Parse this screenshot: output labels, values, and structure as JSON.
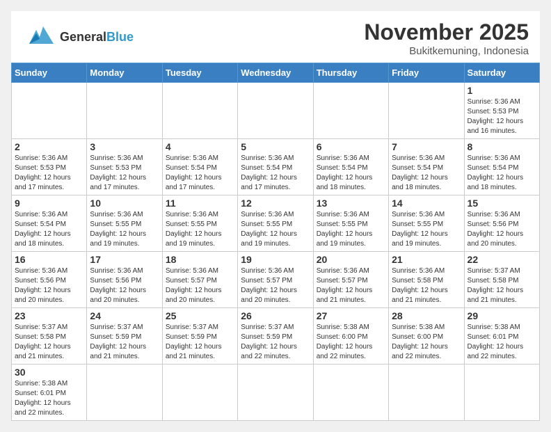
{
  "header": {
    "logo_general": "General",
    "logo_blue": "Blue",
    "month_title": "November 2025",
    "location": "Bukitkemuning, Indonesia"
  },
  "weekdays": [
    "Sunday",
    "Monday",
    "Tuesday",
    "Wednesday",
    "Thursday",
    "Friday",
    "Saturday"
  ],
  "weeks": [
    [
      {
        "day": "",
        "info": ""
      },
      {
        "day": "",
        "info": ""
      },
      {
        "day": "",
        "info": ""
      },
      {
        "day": "",
        "info": ""
      },
      {
        "day": "",
        "info": ""
      },
      {
        "day": "",
        "info": ""
      },
      {
        "day": "1",
        "info": "Sunrise: 5:36 AM\nSunset: 5:53 PM\nDaylight: 12 hours\nand 16 minutes."
      }
    ],
    [
      {
        "day": "2",
        "info": "Sunrise: 5:36 AM\nSunset: 5:53 PM\nDaylight: 12 hours\nand 17 minutes."
      },
      {
        "day": "3",
        "info": "Sunrise: 5:36 AM\nSunset: 5:53 PM\nDaylight: 12 hours\nand 17 minutes."
      },
      {
        "day": "4",
        "info": "Sunrise: 5:36 AM\nSunset: 5:54 PM\nDaylight: 12 hours\nand 17 minutes."
      },
      {
        "day": "5",
        "info": "Sunrise: 5:36 AM\nSunset: 5:54 PM\nDaylight: 12 hours\nand 17 minutes."
      },
      {
        "day": "6",
        "info": "Sunrise: 5:36 AM\nSunset: 5:54 PM\nDaylight: 12 hours\nand 18 minutes."
      },
      {
        "day": "7",
        "info": "Sunrise: 5:36 AM\nSunset: 5:54 PM\nDaylight: 12 hours\nand 18 minutes."
      },
      {
        "day": "8",
        "info": "Sunrise: 5:36 AM\nSunset: 5:54 PM\nDaylight: 12 hours\nand 18 minutes."
      }
    ],
    [
      {
        "day": "9",
        "info": "Sunrise: 5:36 AM\nSunset: 5:54 PM\nDaylight: 12 hours\nand 18 minutes."
      },
      {
        "day": "10",
        "info": "Sunrise: 5:36 AM\nSunset: 5:55 PM\nDaylight: 12 hours\nand 19 minutes."
      },
      {
        "day": "11",
        "info": "Sunrise: 5:36 AM\nSunset: 5:55 PM\nDaylight: 12 hours\nand 19 minutes."
      },
      {
        "day": "12",
        "info": "Sunrise: 5:36 AM\nSunset: 5:55 PM\nDaylight: 12 hours\nand 19 minutes."
      },
      {
        "day": "13",
        "info": "Sunrise: 5:36 AM\nSunset: 5:55 PM\nDaylight: 12 hours\nand 19 minutes."
      },
      {
        "day": "14",
        "info": "Sunrise: 5:36 AM\nSunset: 5:55 PM\nDaylight: 12 hours\nand 19 minutes."
      },
      {
        "day": "15",
        "info": "Sunrise: 5:36 AM\nSunset: 5:56 PM\nDaylight: 12 hours\nand 20 minutes."
      }
    ],
    [
      {
        "day": "16",
        "info": "Sunrise: 5:36 AM\nSunset: 5:56 PM\nDaylight: 12 hours\nand 20 minutes."
      },
      {
        "day": "17",
        "info": "Sunrise: 5:36 AM\nSunset: 5:56 PM\nDaylight: 12 hours\nand 20 minutes."
      },
      {
        "day": "18",
        "info": "Sunrise: 5:36 AM\nSunset: 5:57 PM\nDaylight: 12 hours\nand 20 minutes."
      },
      {
        "day": "19",
        "info": "Sunrise: 5:36 AM\nSunset: 5:57 PM\nDaylight: 12 hours\nand 20 minutes."
      },
      {
        "day": "20",
        "info": "Sunrise: 5:36 AM\nSunset: 5:57 PM\nDaylight: 12 hours\nand 21 minutes."
      },
      {
        "day": "21",
        "info": "Sunrise: 5:36 AM\nSunset: 5:58 PM\nDaylight: 12 hours\nand 21 minutes."
      },
      {
        "day": "22",
        "info": "Sunrise: 5:37 AM\nSunset: 5:58 PM\nDaylight: 12 hours\nand 21 minutes."
      }
    ],
    [
      {
        "day": "23",
        "info": "Sunrise: 5:37 AM\nSunset: 5:58 PM\nDaylight: 12 hours\nand 21 minutes."
      },
      {
        "day": "24",
        "info": "Sunrise: 5:37 AM\nSunset: 5:59 PM\nDaylight: 12 hours\nand 21 minutes."
      },
      {
        "day": "25",
        "info": "Sunrise: 5:37 AM\nSunset: 5:59 PM\nDaylight: 12 hours\nand 21 minutes."
      },
      {
        "day": "26",
        "info": "Sunrise: 5:37 AM\nSunset: 5:59 PM\nDaylight: 12 hours\nand 22 minutes."
      },
      {
        "day": "27",
        "info": "Sunrise: 5:38 AM\nSunset: 6:00 PM\nDaylight: 12 hours\nand 22 minutes."
      },
      {
        "day": "28",
        "info": "Sunrise: 5:38 AM\nSunset: 6:00 PM\nDaylight: 12 hours\nand 22 minutes."
      },
      {
        "day": "29",
        "info": "Sunrise: 5:38 AM\nSunset: 6:01 PM\nDaylight: 12 hours\nand 22 minutes."
      }
    ],
    [
      {
        "day": "30",
        "info": "Sunrise: 5:38 AM\nSunset: 6:01 PM\nDaylight: 12 hours\nand 22 minutes."
      },
      {
        "day": "",
        "info": ""
      },
      {
        "day": "",
        "info": ""
      },
      {
        "day": "",
        "info": ""
      },
      {
        "day": "",
        "info": ""
      },
      {
        "day": "",
        "info": ""
      },
      {
        "day": "",
        "info": ""
      }
    ]
  ]
}
